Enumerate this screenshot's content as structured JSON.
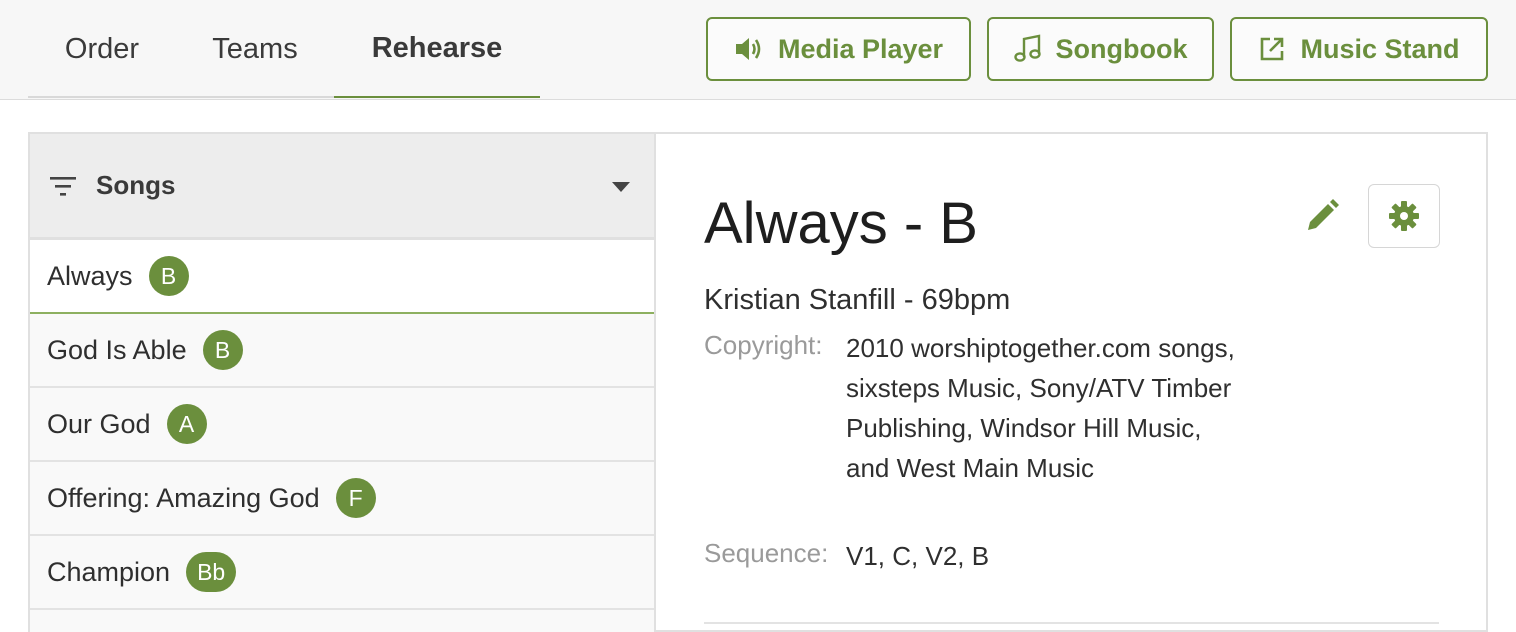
{
  "tabs": [
    {
      "label": "Order"
    },
    {
      "label": "Teams"
    },
    {
      "label": "Rehearse"
    }
  ],
  "toolbar": {
    "media_player": "Media Player",
    "songbook": "Songbook",
    "music_stand": "Music Stand"
  },
  "sidebar": {
    "title": "Songs",
    "songs": [
      {
        "name": "Always",
        "key": "B"
      },
      {
        "name": "God Is Able",
        "key": "B"
      },
      {
        "name": "Our God",
        "key": "A"
      },
      {
        "name": "Offering: Amazing God",
        "key": "F"
      },
      {
        "name": "Champion",
        "key": "Bb"
      }
    ]
  },
  "detail": {
    "title": "Always - B",
    "artist_line": "Kristian Stanfill - 69bpm",
    "copyright_label": "Copyright:",
    "copyright_value": "2010 worshiptogether.com songs, sixsteps Music, Sony/ATV Timber Publishing, Windsor Hill Music, and West Main Music",
    "sequence_label": "Sequence:",
    "sequence_value": "V1, C, V2, B"
  },
  "colors": {
    "accent": "#6b8f3d",
    "badge_bg": "#6b8f3d"
  }
}
